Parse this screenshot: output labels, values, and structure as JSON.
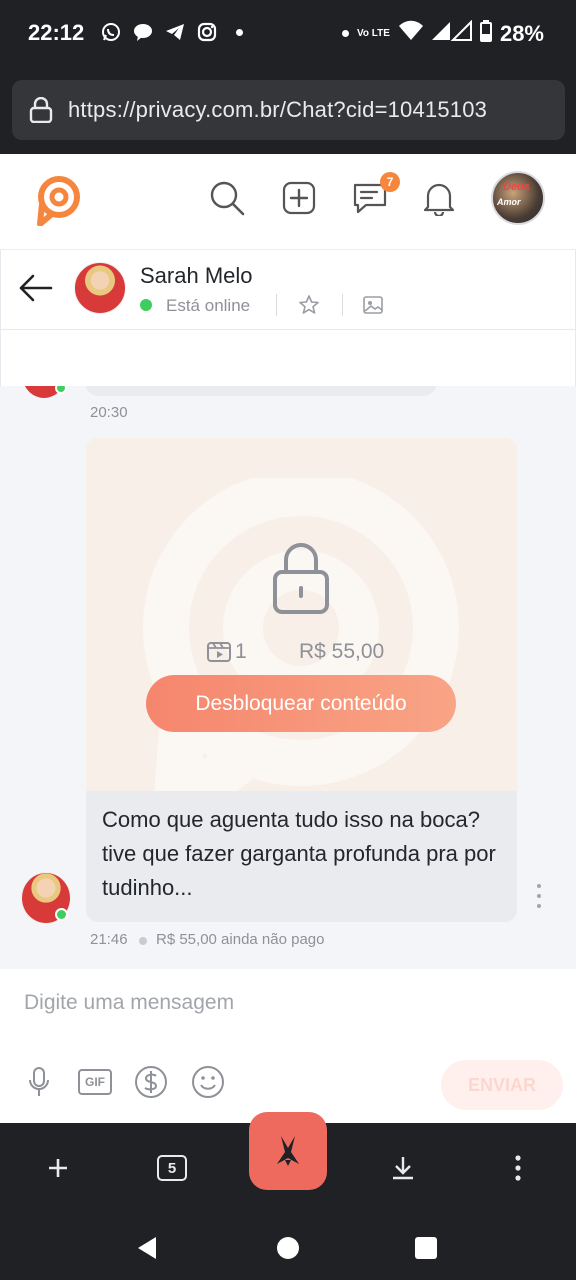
{
  "status_bar": {
    "time": "22:12",
    "battery": "28%",
    "network_label": "Vo LTE",
    "icons": [
      "whatsapp-icon",
      "chat-icon",
      "telegram-icon",
      "instagram-icon",
      "dot-icon",
      "wifi-icon",
      "signal-icon",
      "battery-icon"
    ]
  },
  "browser": {
    "url": "https://privacy.com.br/Chat?cid=10415103",
    "tab_count": "5"
  },
  "app_header": {
    "icons": [
      "privacy-logo-icon",
      "search-icon",
      "add-post-icon",
      "messages-icon",
      "bell-icon"
    ],
    "messages_badge": "7",
    "profile_text_1": "Deus",
    "profile_text_2": "Amor"
  },
  "chat": {
    "contact_name": "Sarah Melo",
    "status": "Está online"
  },
  "messages": {
    "prev_time": "20:30",
    "locked_media": {
      "video_count": "1",
      "price": "R$ 55,00",
      "unlock_label": "Desbloquear conteúdo"
    },
    "text": "Como que aguenta tudo isso na boca? tive que fazer garganta profunda pra por tudinho...",
    "time": "21:46",
    "payment_status": "R$ 55,00 ainda não pago"
  },
  "composer": {
    "placeholder": "Digite uma mensagem",
    "gif_label": "GIF",
    "send_label": "ENVIAR"
  },
  "colors": {
    "accent": "#f6863e",
    "unlock_button": "#f5866d",
    "online": "#3ecd5f",
    "brave": "#ef6a5e"
  }
}
